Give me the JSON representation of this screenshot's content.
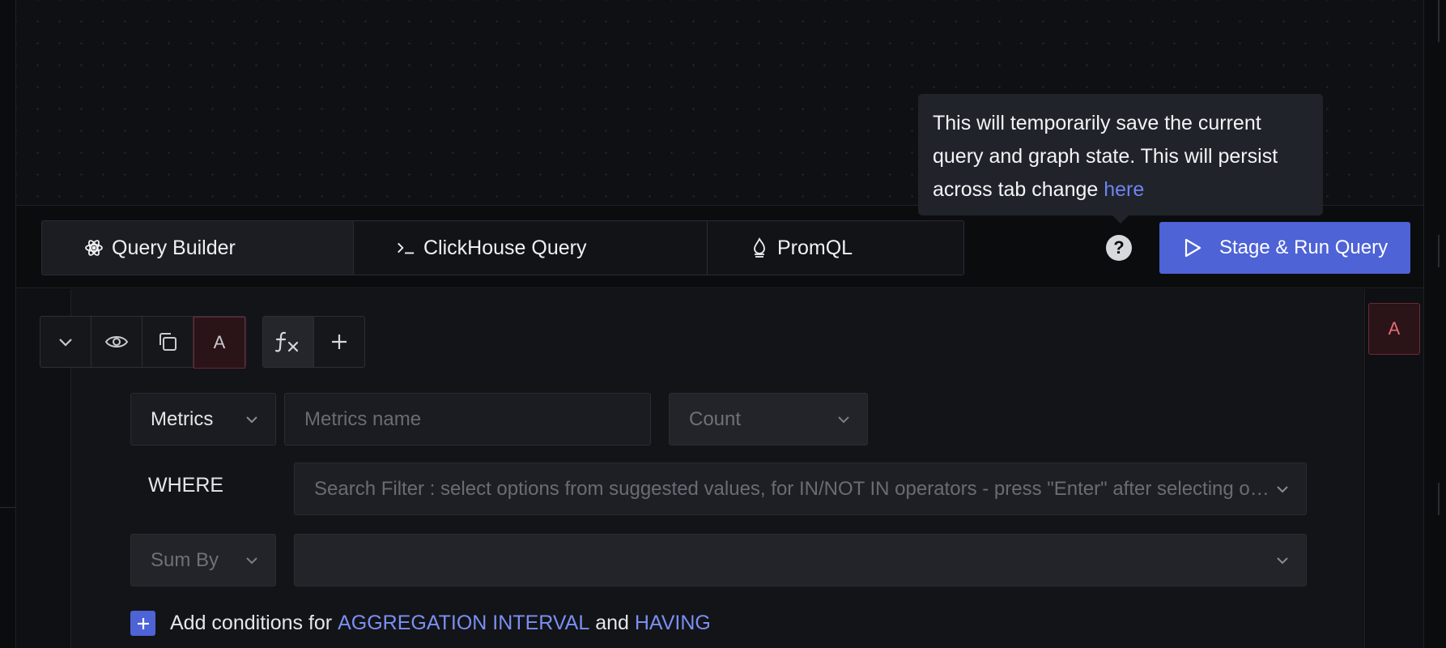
{
  "tooltip": {
    "text": "This will temporarily save the current query and graph state. This will persist across tab change ",
    "link": "here"
  },
  "tabs": [
    {
      "label": "Query Builder",
      "icon": "atom-icon",
      "active": true
    },
    {
      "label": "ClickHouse Query",
      "icon": "terminal-icon",
      "active": false
    },
    {
      "label": "PromQL",
      "icon": "flame-icon",
      "active": false
    }
  ],
  "help": {
    "glyph": "?"
  },
  "run_button": {
    "label": "Stage & Run Query",
    "icon": "play-icon"
  },
  "query": {
    "letter": "A",
    "right_letter": "A",
    "data_source": "Metrics",
    "metric_placeholder": "Metrics name",
    "aggregate": "Count",
    "where_label": "WHERE",
    "filter_placeholder": "Search Filter : select options from suggested values, for IN/NOT IN operators - press \"Enter\" after selecting options",
    "sum_by": "Sum By",
    "group_by_value": ""
  },
  "add_conditions": {
    "prefix": "Add conditions for ",
    "first": "AGGREGATION INTERVAL",
    "middle": " and ",
    "second": "HAVING"
  },
  "colors": {
    "accent": "#4e63d6",
    "link": "#6e84f0",
    "query_letter": "#e46a78"
  }
}
